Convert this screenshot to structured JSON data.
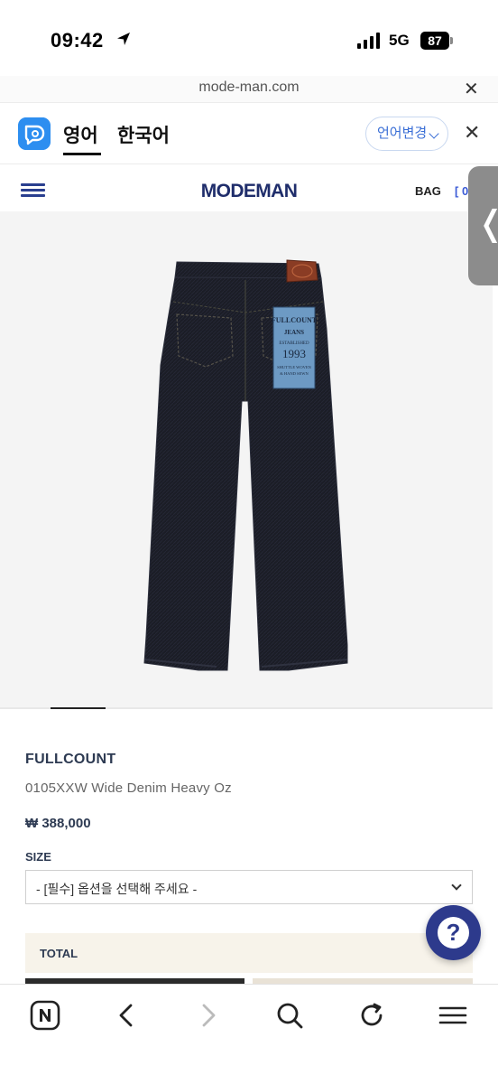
{
  "status": {
    "time": "09:42",
    "network": "5G",
    "battery": "87"
  },
  "browser": {
    "url": "mode-man.com"
  },
  "translate": {
    "from_lang": "영어",
    "to_lang": "한국어",
    "change_label": "언어변경"
  },
  "site": {
    "brand": "MODEMAN",
    "bag_label": "BAG",
    "bag_count": "[ 0"
  },
  "product": {
    "brand": "FULLCOUNT",
    "name": "0105XXW Wide Denim Heavy Oz",
    "price": "₩ 388,000",
    "size_label": "SIZE",
    "size_select_value": "- [필수] 옵션을 선택해 주세요 -",
    "total_label": "TOTAL",
    "patch": {
      "brand": "FULLCOUNT",
      "jeans": "JEANS",
      "established": "ESTABLISHED",
      "year": "1993",
      "tagline1": "SHUTTLE WOVEN",
      "tagline2": "& HAND SEWN"
    }
  },
  "help_button": "?",
  "icons": {
    "menu": "hamburger-icon",
    "close": "close-icon",
    "translate_logo": "papago-logo-icon",
    "location": "location-arrow-icon",
    "back": "chevron-left-icon",
    "forward": "chevron-right-icon",
    "search": "search-icon",
    "refresh": "refresh-icon",
    "tabs_menu": "menu-icon",
    "home": "naver-n-icon",
    "panel": "chevron-left-icon"
  },
  "colors": {
    "accent": "#2d3a8c",
    "brand_navy": "#1f2d6b",
    "link_blue": "#3b6fd6",
    "denim": "#1b1d26"
  }
}
